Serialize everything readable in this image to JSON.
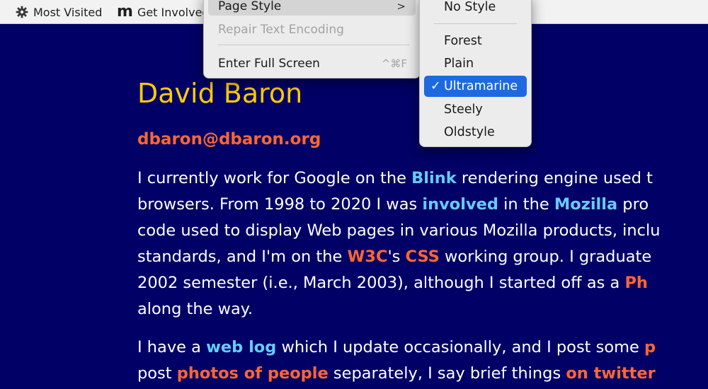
{
  "bookmarks": {
    "most_visited": "Most Visited",
    "most_visited_icon": "gear-icon",
    "get_involved": "Get Involved",
    "get_involved_icon": "mozilla-m-logo",
    "get_involved_logo_text": "m"
  },
  "view_menu": {
    "page_style": "Page Style",
    "page_style_arrow": ">",
    "repair_text_encoding": "Repair Text Encoding",
    "enter_full_screen": "Enter Full Screen",
    "enter_full_screen_shortcut": "^⌘F"
  },
  "page_style_menu": {
    "items": [
      "No Style",
      "Forest",
      "Plain",
      "Ultramarine",
      "Steely",
      "Oldstyle"
    ],
    "selected": "Ultramarine",
    "check": "✓"
  },
  "page": {
    "name": "David Baron",
    "email": "dbaron@dbaron.org",
    "p1": [
      [
        "I currently work for Google on the ",
        "Blink",
        " rendering engine used t"
      ],
      [
        "browsers. From 1998 to 2020 I was ",
        "involved",
        " in the ",
        "Mozilla",
        " pro"
      ],
      [
        "code used to display Web pages in various Mozilla products, inclu"
      ],
      [
        "standards, and I'm on the ",
        "W3C",
        "'s ",
        "CSS",
        " working group. I graduate"
      ],
      [
        "2002 semester (i.e., March 2003), although I started off as a ",
        "Ph"
      ],
      [
        "along the way."
      ]
    ],
    "p2": [
      [
        "I have a ",
        "web log",
        " which I update occasionally, and I post some ",
        "p"
      ],
      [
        "post ",
        "photos of people",
        " separately, I say brief things ",
        "on twitter"
      ]
    ]
  },
  "colors": {
    "background": "#000066",
    "heading": "#ffcc00",
    "link_blue": "#66ccff",
    "link_orange": "#ff6633",
    "menu_selection": "#1d6ae0"
  }
}
